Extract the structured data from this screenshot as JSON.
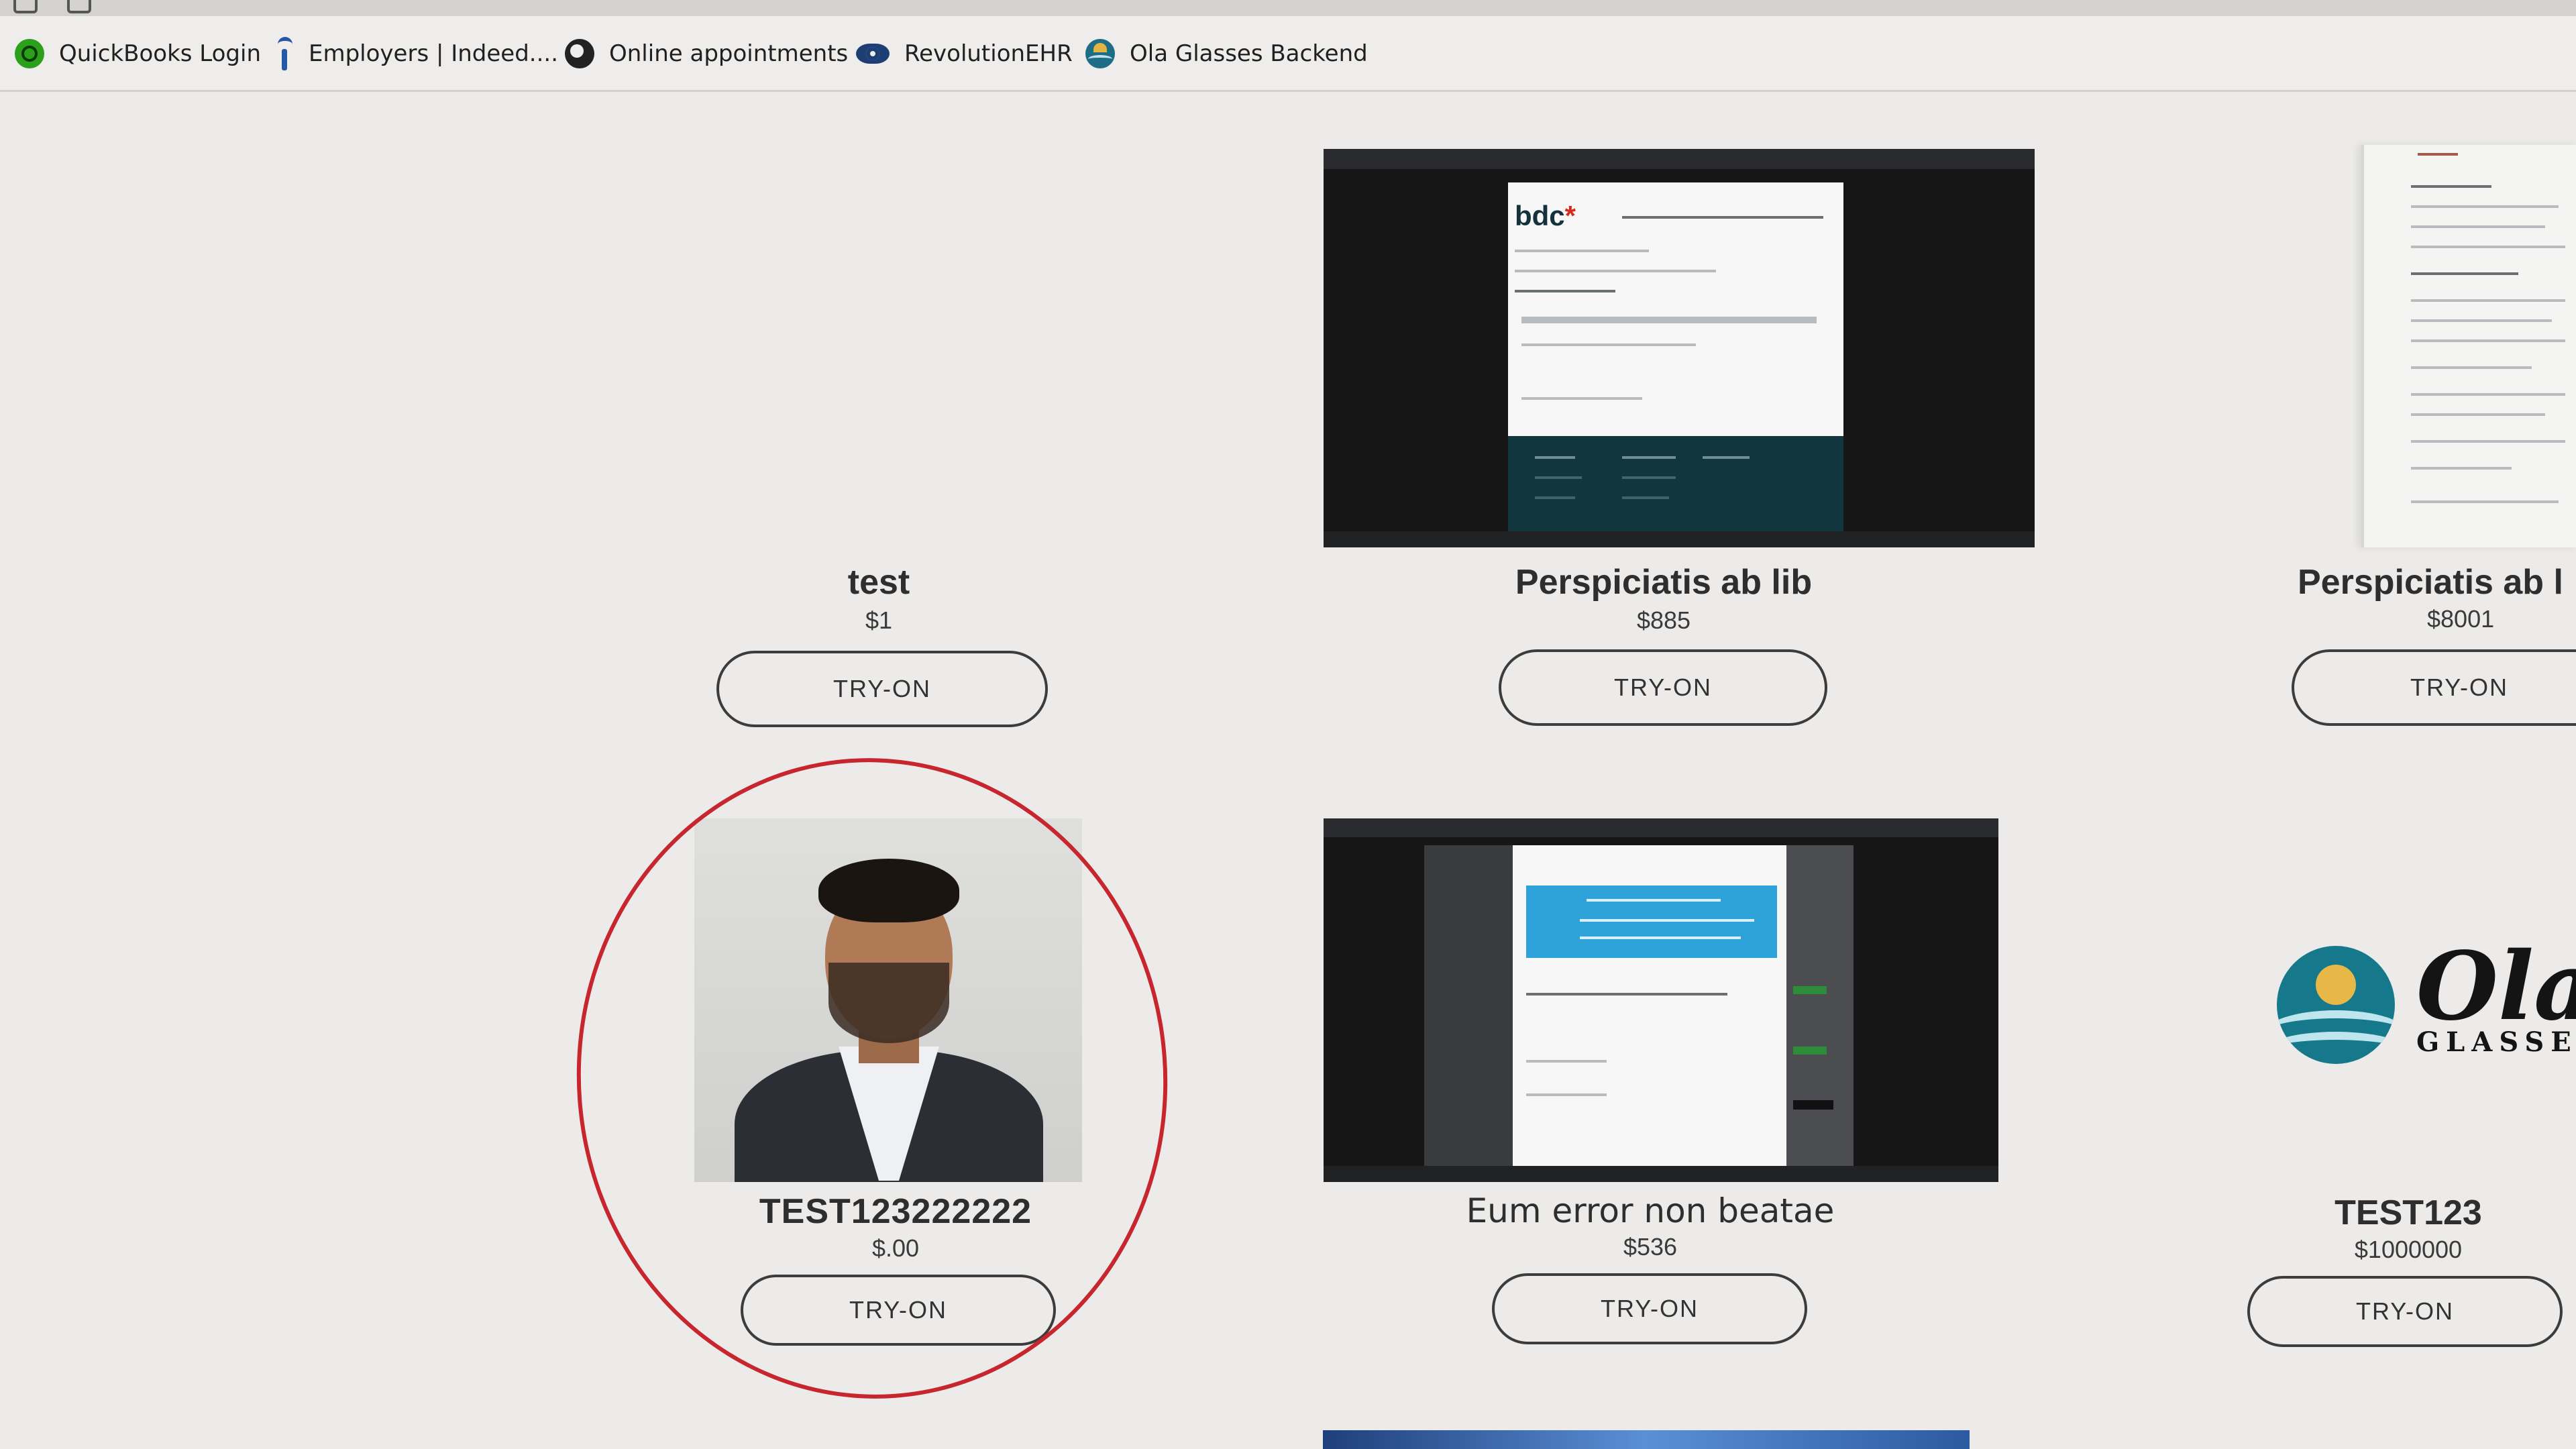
{
  "bookmarks": [
    {
      "label": "QuickBooks Login",
      "icon": "quickbooks-icon"
    },
    {
      "label": "Employers | Indeed....",
      "icon": "indeed-icon"
    },
    {
      "label": "Online appointments",
      "icon": "globe-icon"
    },
    {
      "label": "RevolutionEHR",
      "icon": "eye-icon"
    },
    {
      "label": "Ola Glasses Backend",
      "icon": "ola-icon"
    }
  ],
  "products": [
    {
      "name": "test",
      "price": "$1",
      "button": "TRY-ON",
      "image": "none"
    },
    {
      "name": "Perspiciatis ab lib",
      "price": "$885",
      "button": "TRY-ON",
      "image": "bdc-screenshot"
    },
    {
      "name": "Perspiciatis ab l",
      "price": "$8001",
      "button": "TRY-ON",
      "image": "document-scan"
    },
    {
      "name": "TEST123222222",
      "price": "$.00",
      "button": "TRY-ON",
      "image": "portrait-photo"
    },
    {
      "name": "Eum error non beatae",
      "price": "$536",
      "button": "TRY-ON",
      "image": "dialog-screenshot"
    },
    {
      "name": "TEST123",
      "price": "$1000000",
      "button": "TRY-ON",
      "image": "ola-logo"
    }
  ],
  "thumb_text": {
    "bdc_logo": "bdc",
    "ola_word": "Ola",
    "ola_sub": "GLASSES"
  },
  "colors": {
    "annotation_circle": "#c8262e",
    "background": "#ecebe9"
  }
}
